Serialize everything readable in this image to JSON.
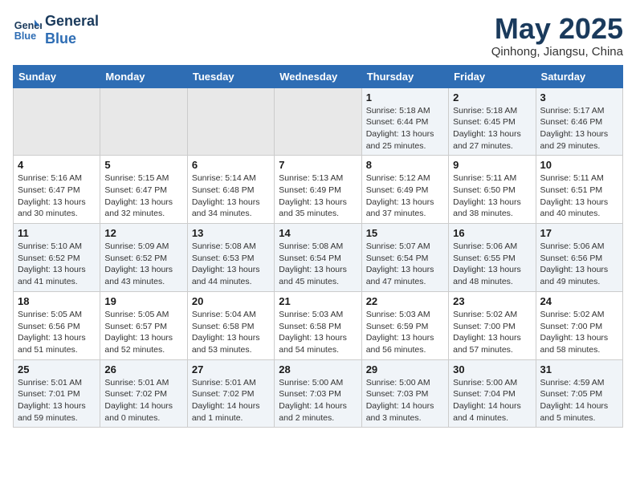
{
  "header": {
    "logo_line1": "General",
    "logo_line2": "Blue",
    "title": "May 2025",
    "subtitle": "Qinhong, Jiangsu, China"
  },
  "days_of_week": [
    "Sunday",
    "Monday",
    "Tuesday",
    "Wednesday",
    "Thursday",
    "Friday",
    "Saturday"
  ],
  "weeks": [
    [
      {
        "day": "",
        "info": ""
      },
      {
        "day": "",
        "info": ""
      },
      {
        "day": "",
        "info": ""
      },
      {
        "day": "",
        "info": ""
      },
      {
        "day": "1",
        "info": "Sunrise: 5:18 AM\nSunset: 6:44 PM\nDaylight: 13 hours\nand 25 minutes."
      },
      {
        "day": "2",
        "info": "Sunrise: 5:18 AM\nSunset: 6:45 PM\nDaylight: 13 hours\nand 27 minutes."
      },
      {
        "day": "3",
        "info": "Sunrise: 5:17 AM\nSunset: 6:46 PM\nDaylight: 13 hours\nand 29 minutes."
      }
    ],
    [
      {
        "day": "4",
        "info": "Sunrise: 5:16 AM\nSunset: 6:47 PM\nDaylight: 13 hours\nand 30 minutes."
      },
      {
        "day": "5",
        "info": "Sunrise: 5:15 AM\nSunset: 6:47 PM\nDaylight: 13 hours\nand 32 minutes."
      },
      {
        "day": "6",
        "info": "Sunrise: 5:14 AM\nSunset: 6:48 PM\nDaylight: 13 hours\nand 34 minutes."
      },
      {
        "day": "7",
        "info": "Sunrise: 5:13 AM\nSunset: 6:49 PM\nDaylight: 13 hours\nand 35 minutes."
      },
      {
        "day": "8",
        "info": "Sunrise: 5:12 AM\nSunset: 6:49 PM\nDaylight: 13 hours\nand 37 minutes."
      },
      {
        "day": "9",
        "info": "Sunrise: 5:11 AM\nSunset: 6:50 PM\nDaylight: 13 hours\nand 38 minutes."
      },
      {
        "day": "10",
        "info": "Sunrise: 5:11 AM\nSunset: 6:51 PM\nDaylight: 13 hours\nand 40 minutes."
      }
    ],
    [
      {
        "day": "11",
        "info": "Sunrise: 5:10 AM\nSunset: 6:52 PM\nDaylight: 13 hours\nand 41 minutes."
      },
      {
        "day": "12",
        "info": "Sunrise: 5:09 AM\nSunset: 6:52 PM\nDaylight: 13 hours\nand 43 minutes."
      },
      {
        "day": "13",
        "info": "Sunrise: 5:08 AM\nSunset: 6:53 PM\nDaylight: 13 hours\nand 44 minutes."
      },
      {
        "day": "14",
        "info": "Sunrise: 5:08 AM\nSunset: 6:54 PM\nDaylight: 13 hours\nand 45 minutes."
      },
      {
        "day": "15",
        "info": "Sunrise: 5:07 AM\nSunset: 6:54 PM\nDaylight: 13 hours\nand 47 minutes."
      },
      {
        "day": "16",
        "info": "Sunrise: 5:06 AM\nSunset: 6:55 PM\nDaylight: 13 hours\nand 48 minutes."
      },
      {
        "day": "17",
        "info": "Sunrise: 5:06 AM\nSunset: 6:56 PM\nDaylight: 13 hours\nand 49 minutes."
      }
    ],
    [
      {
        "day": "18",
        "info": "Sunrise: 5:05 AM\nSunset: 6:56 PM\nDaylight: 13 hours\nand 51 minutes."
      },
      {
        "day": "19",
        "info": "Sunrise: 5:05 AM\nSunset: 6:57 PM\nDaylight: 13 hours\nand 52 minutes."
      },
      {
        "day": "20",
        "info": "Sunrise: 5:04 AM\nSunset: 6:58 PM\nDaylight: 13 hours\nand 53 minutes."
      },
      {
        "day": "21",
        "info": "Sunrise: 5:03 AM\nSunset: 6:58 PM\nDaylight: 13 hours\nand 54 minutes."
      },
      {
        "day": "22",
        "info": "Sunrise: 5:03 AM\nSunset: 6:59 PM\nDaylight: 13 hours\nand 56 minutes."
      },
      {
        "day": "23",
        "info": "Sunrise: 5:02 AM\nSunset: 7:00 PM\nDaylight: 13 hours\nand 57 minutes."
      },
      {
        "day": "24",
        "info": "Sunrise: 5:02 AM\nSunset: 7:00 PM\nDaylight: 13 hours\nand 58 minutes."
      }
    ],
    [
      {
        "day": "25",
        "info": "Sunrise: 5:01 AM\nSunset: 7:01 PM\nDaylight: 13 hours\nand 59 minutes."
      },
      {
        "day": "26",
        "info": "Sunrise: 5:01 AM\nSunset: 7:02 PM\nDaylight: 14 hours\nand 0 minutes."
      },
      {
        "day": "27",
        "info": "Sunrise: 5:01 AM\nSunset: 7:02 PM\nDaylight: 14 hours\nand 1 minute."
      },
      {
        "day": "28",
        "info": "Sunrise: 5:00 AM\nSunset: 7:03 PM\nDaylight: 14 hours\nand 2 minutes."
      },
      {
        "day": "29",
        "info": "Sunrise: 5:00 AM\nSunset: 7:03 PM\nDaylight: 14 hours\nand 3 minutes."
      },
      {
        "day": "30",
        "info": "Sunrise: 5:00 AM\nSunset: 7:04 PM\nDaylight: 14 hours\nand 4 minutes."
      },
      {
        "day": "31",
        "info": "Sunrise: 4:59 AM\nSunset: 7:05 PM\nDaylight: 14 hours\nand 5 minutes."
      }
    ]
  ]
}
